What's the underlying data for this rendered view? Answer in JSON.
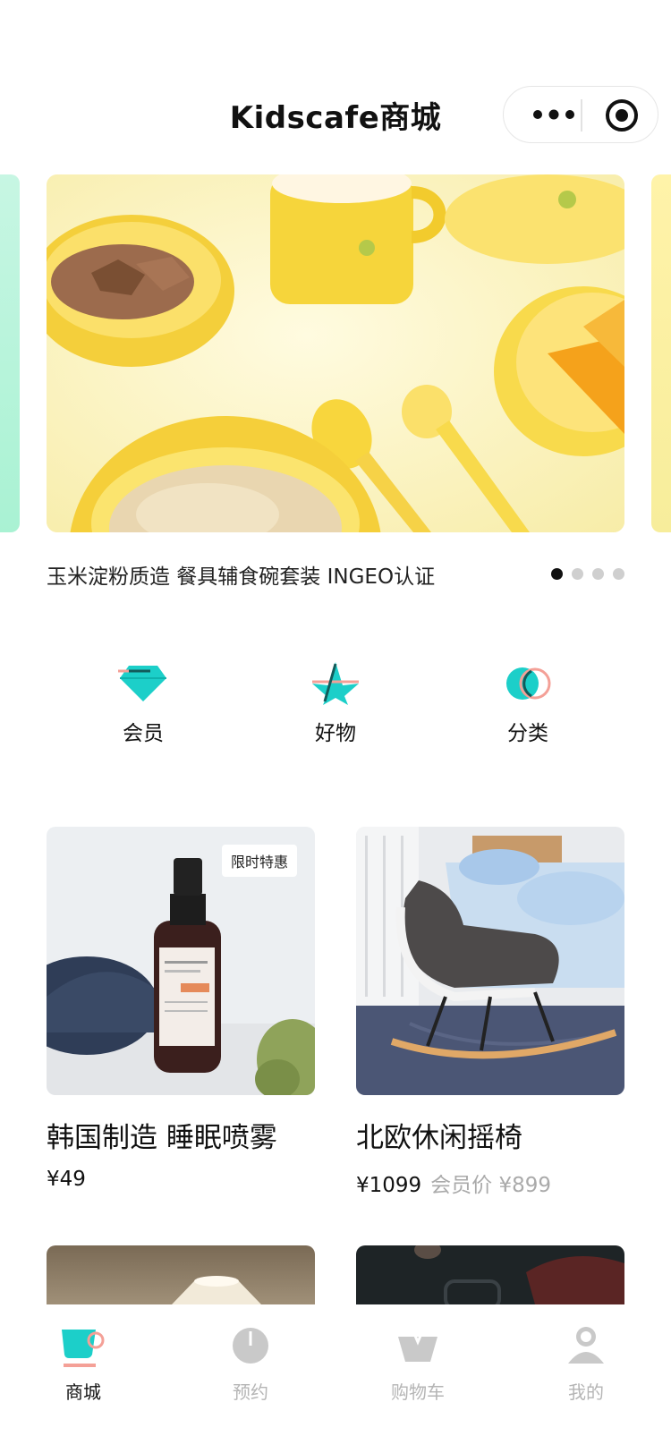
{
  "nav": {
    "title": "Kidscafe商城"
  },
  "banner": {
    "caption": "玉米淀粉质造 餐具辅食碗套装 INGEO认证",
    "image_text": "corn cutlery",
    "page_count": 4,
    "active_page": 1
  },
  "entries": [
    {
      "label": "会员",
      "icon": "diamond-icon"
    },
    {
      "label": "好物",
      "icon": "star-icon"
    },
    {
      "label": "分类",
      "icon": "circles-icon"
    }
  ],
  "products": [
    {
      "name": "韩国制造 睡眠喷雾",
      "price": "¥49",
      "tag": "限时特惠",
      "member_price": ""
    },
    {
      "name": "北欧休闲摇椅",
      "price": "¥1099",
      "tag": "",
      "member_price": "会员价 ¥899"
    }
  ],
  "tabs": [
    {
      "label": "商城",
      "icon": "cup-icon",
      "active": true
    },
    {
      "label": "预约",
      "icon": "clock-icon",
      "active": false
    },
    {
      "label": "购物车",
      "icon": "cart-icon",
      "active": false
    },
    {
      "label": "我的",
      "icon": "profile-icon",
      "active": false
    }
  ],
  "colors": {
    "accent": "#1ccfc9",
    "coral": "#f4a097",
    "muted": "#b5b5b5"
  }
}
